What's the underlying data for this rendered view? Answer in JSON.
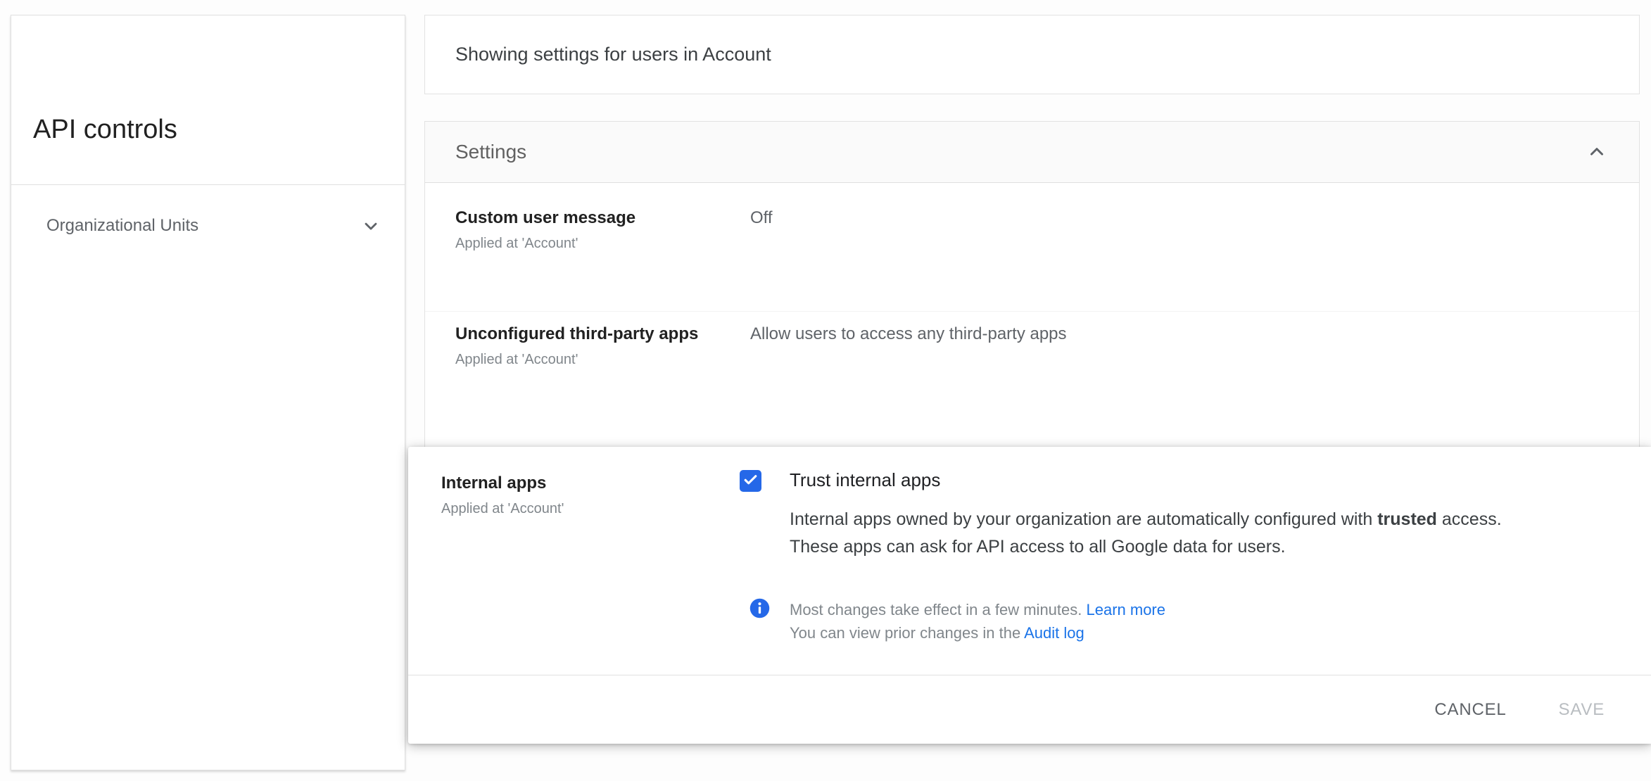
{
  "topbar": {
    "scope_text": "Showing settings for users in Account"
  },
  "sidebar": {
    "title": "API controls",
    "org_units": {
      "label": "Organizational Units",
      "icon": "chevron-down-icon"
    }
  },
  "settings": {
    "section_title": "Settings",
    "collapse_icon": "chevron-up-icon",
    "rows": [
      {
        "label": "Custom user message",
        "applied_at": "Applied at 'Account'",
        "value": "Off"
      },
      {
        "label": "Unconfigured third-party apps",
        "applied_at": "Applied at 'Account'",
        "value": "Allow users to access any third-party apps"
      }
    ]
  },
  "edit_panel": {
    "label": "Internal apps",
    "applied_at": "Applied at 'Account'",
    "checkbox_checked": true,
    "checkbox_label": "Trust internal apps",
    "description": {
      "line1_before": "Internal apps owned by your organization are automatically configured with ",
      "line1_bold": "trusted",
      "line1_after": " access.",
      "line2": "These apps can ask for API access to all Google data for users."
    },
    "info_note": {
      "icon": "info-icon",
      "line1_text": "Most changes take effect in a few minutes. ",
      "line1_link": "Learn more",
      "line2_text": "You can view prior changes in the ",
      "line2_link": "Audit log"
    },
    "actions": {
      "cancel": "CANCEL",
      "save": "SAVE"
    }
  },
  "colors": {
    "checkbox_blue": "#2568e8",
    "link_blue": "#1a73e8",
    "cancel_text": "#5f6368",
    "save_disabled": "#b9bdc1",
    "header_bg": "#fafafa",
    "border": "#e0e0e0"
  }
}
